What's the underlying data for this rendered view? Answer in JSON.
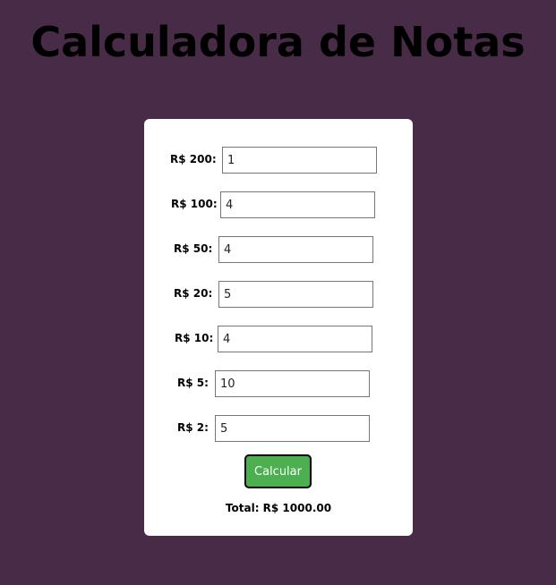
{
  "page": {
    "title": "Calculadora de Notas"
  },
  "form": {
    "notes": [
      {
        "label": "R$ 200:",
        "value": "1"
      },
      {
        "label": "R$ 100:",
        "value": "4"
      },
      {
        "label": "R$ 50:",
        "value": "4"
      },
      {
        "label": "R$ 20:",
        "value": "5"
      },
      {
        "label": "R$ 10:",
        "value": "4"
      },
      {
        "label": "R$ 5:",
        "value": "10"
      },
      {
        "label": "R$ 2:",
        "value": "5"
      }
    ],
    "button_label": "Calcular",
    "total_text": "Total: R$ 1000.00"
  },
  "colors": {
    "background": "#472b47",
    "card": "#ffffff",
    "button": "#4caf50"
  }
}
